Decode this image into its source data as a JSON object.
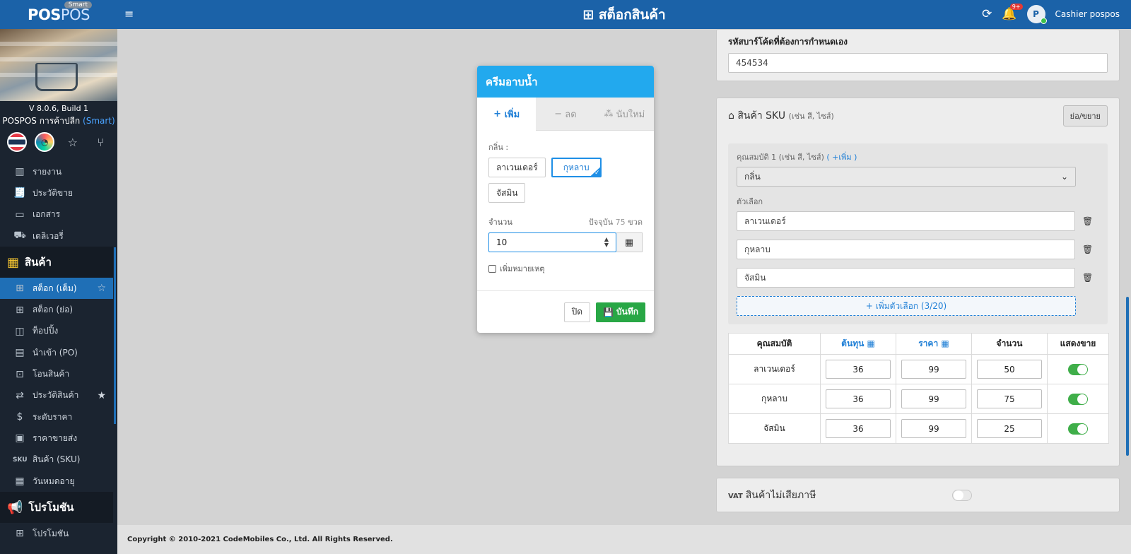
{
  "brand": {
    "logo_bold": "POS",
    "logo_light": "POS",
    "badge": "Smart"
  },
  "sidebar": {
    "version": "V 8.0.6, Build 1",
    "store_name": "POSPOS การค้าปลีก",
    "store_tier": "(Smart)",
    "items": [
      {
        "label": "รายงาน",
        "icon": "bar-chart-icon"
      },
      {
        "label": "ประวัติขาย",
        "icon": "receipt-icon"
      },
      {
        "label": "เอกสาร",
        "icon": "folder-icon"
      },
      {
        "label": "เดลิเวอรี่",
        "icon": "truck-icon"
      }
    ],
    "section_products": "สินค้า",
    "product_items": [
      {
        "label": "สต็อก (เต็ม)",
        "active": true
      },
      {
        "label": "สต็อก (ย่อ)"
      },
      {
        "label": "ท็อปปิ้ง"
      },
      {
        "label": "นำเข้า (PO)"
      },
      {
        "label": "โอนสินค้า"
      },
      {
        "label": "ประวัติสินค้า"
      },
      {
        "label": "ระดับราคา"
      },
      {
        "label": "ราคาขายส่ง"
      },
      {
        "label": "สินค้า (SKU)"
      },
      {
        "label": "วันหมดอายุ"
      }
    ],
    "section_promo": "โปรโมชัน",
    "promo_item": "โปรโมชัน"
  },
  "topbar": {
    "title": "สต็อกสินค้า",
    "notif_badge": "9+",
    "user": "Cashier pospos",
    "avatar_letter": "P"
  },
  "barcode": {
    "label": "รหัสบาร์โค้ดที่ต้องการกำหนดเอง",
    "value": "454534"
  },
  "sku": {
    "title": "สินค้า SKU",
    "subtitle": "(เช่น สี, ไซส์)",
    "toggle_btn": "ย่อ/ขยาย",
    "attr_label": "คุณสมบัติ 1 (เช่น สี, ไซส์)",
    "attr_add": "( +เพิ่ม )",
    "attr_value": "กลิ่น",
    "options_label": "ตัวเลือก",
    "options": [
      "ลาเวนเดอร์",
      "กุหลาบ",
      "จัสมิน"
    ],
    "add_option": "เพิ่มตัวเลือก (3/20)",
    "table_headers": [
      "คุณสมบัติ",
      "ต้นทุน",
      "ราคา",
      "จำนวน",
      "แสดงขาย"
    ],
    "rows": [
      {
        "name": "ลาเวนเดอร์",
        "cost": "36",
        "price": "99",
        "qty": "50"
      },
      {
        "name": "กุหลาบ",
        "cost": "36",
        "price": "99",
        "qty": "75"
      },
      {
        "name": "จัสมิน",
        "cost": "36",
        "price": "99",
        "qty": "25"
      }
    ]
  },
  "vat": {
    "prefix": "VAT",
    "label": "สินค้าไม่เสียภาษี"
  },
  "footer": {
    "text": "Copyright © 2010-2021 CodeMobiles Co., Ltd. All Rights Reserved."
  },
  "modal": {
    "title": "ครีมอาบน้ำ",
    "tabs": [
      "เพิ่ม",
      "ลด",
      "นับใหม่"
    ],
    "scent_label": "กลิ่น :",
    "chips": [
      "ลาเวนเดอร์",
      "กุหลาบ",
      "จัสมิน"
    ],
    "qty_label": "จำนวน",
    "current_label": "ปัจจุบัน",
    "current_value": "75",
    "current_unit": "ขวด",
    "qty_value": "10",
    "note_label": "เพิ่มหมายเหตุ",
    "close": "ปิด",
    "save": "บันทึก"
  },
  "colors": {
    "primary": "#1b62a8",
    "accent": "#22a9ee",
    "success": "#28a745"
  }
}
